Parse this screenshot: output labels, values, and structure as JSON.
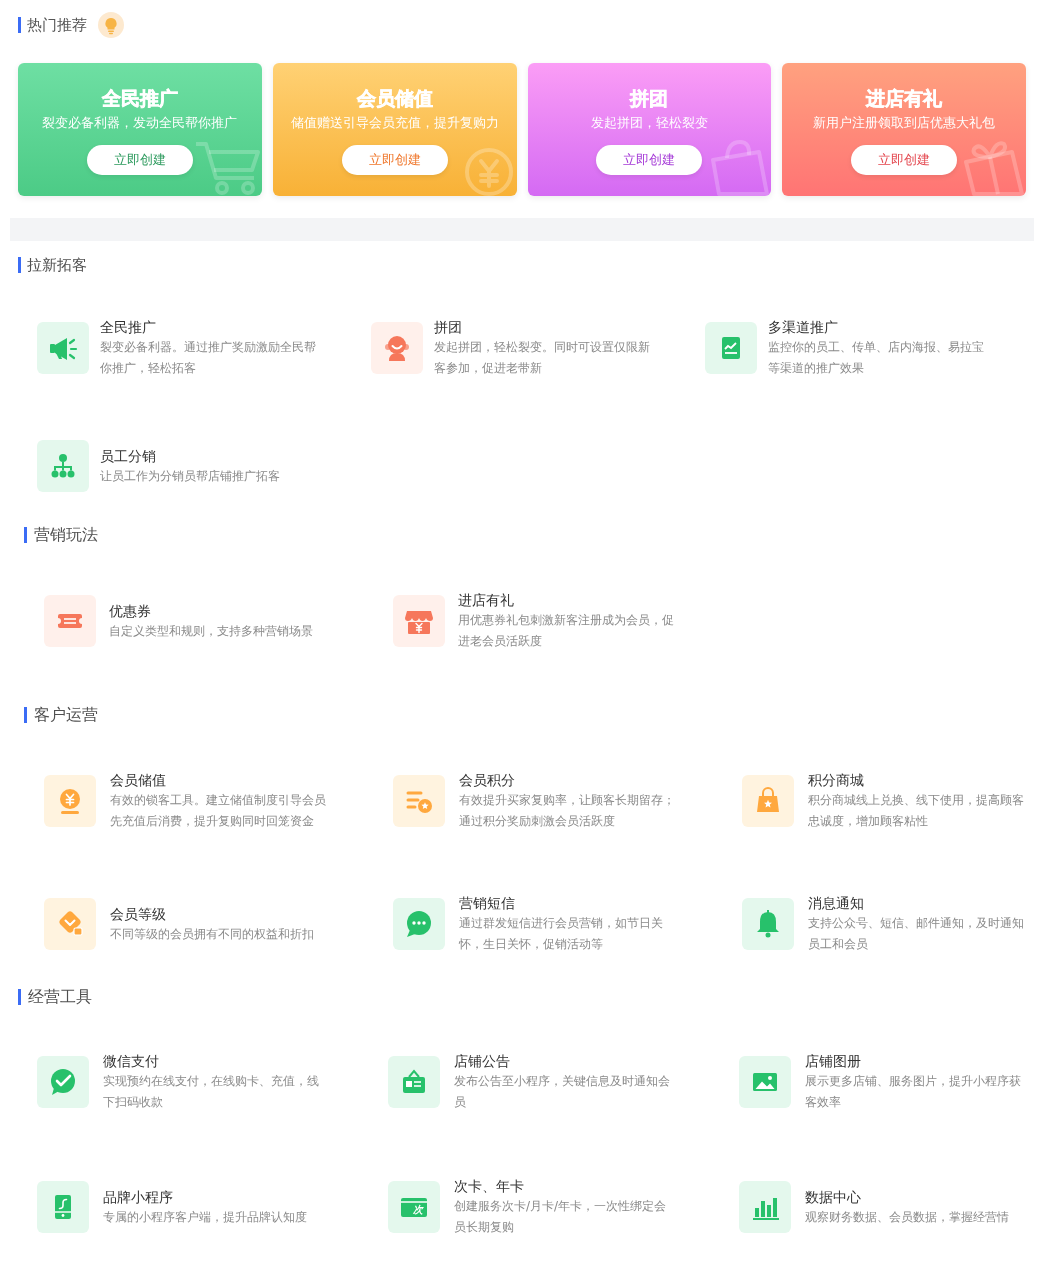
{
  "hot": {
    "title": "热门推荐",
    "cards": [
      {
        "title": "全民推广",
        "subtitle": "裂变必备利器，发动全民帮你推广",
        "button": "立即创建"
      },
      {
        "title": "会员储值",
        "subtitle": "储值赠送引导会员充值，提升复购力",
        "button": "立即创建"
      },
      {
        "title": "拼团",
        "subtitle": "发起拼团，轻松裂变",
        "button": "立即创建"
      },
      {
        "title": "进店有礼",
        "subtitle": "新用户注册领取到店优惠大礼包",
        "button": "立即创建"
      }
    ]
  },
  "sections": [
    {
      "title": "拉新拓客",
      "items": [
        {
          "title": "全民推广",
          "description": "裂变必备利器。通过推广奖励激励全民帮你推广，轻松拓客"
        },
        {
          "title": "拼团",
          "description": "发起拼团，轻松裂变。同时可设置仅限新客参加，促进老带新"
        },
        {
          "title": "多渠道推广",
          "description": "监控你的员工、传单、店内海报、易拉宝等渠道的推广效果"
        },
        {
          "title": "员工分销",
          "description": "让员工作为分销员帮店铺推广拓客"
        }
      ]
    },
    {
      "title": "营销玩法",
      "items": [
        {
          "title": "优惠券",
          "description": "自定义类型和规则，支持多种营销场景"
        },
        {
          "title": "进店有礼",
          "description": "用优惠券礼包刺激新客注册成为会员，促进老会员活跃度"
        }
      ]
    },
    {
      "title": "客户运营",
      "items": [
        {
          "title": "会员储值",
          "description": "有效的锁客工具。建立储值制度引导会员先充值后消费，提升复购同时回笼资金"
        },
        {
          "title": "会员积分",
          "description": "有效提升买家复购率，让顾客长期留存；通过积分奖励刺激会员活跃度"
        },
        {
          "title": "积分商城",
          "description": "积分商城线上兑换、线下使用，提高顾客忠诚度，增加顾客粘性"
        },
        {
          "title": "会员等级",
          "description": "不同等级的会员拥有不同的权益和折扣"
        },
        {
          "title": "营销短信",
          "description": "通过群发短信进行会员营销，如节日关怀，生日关怀，促销活动等"
        },
        {
          "title": "消息通知",
          "description": "支持公众号、短信、邮件通知，及时通知员工和会员"
        }
      ]
    },
    {
      "title": "经营工具",
      "items": [
        {
          "title": "微信支付",
          "description": "实现预约在线支付，在线购卡、充值，线下扫码收款"
        },
        {
          "title": "店铺公告",
          "description": "发布公告至小程序，关键信息及时通知会员"
        },
        {
          "title": "店铺图册",
          "description": "展示更多店铺、服务图片，提升小程序获客效率"
        },
        {
          "title": "品牌小程序",
          "description": "专属的小程序客户端，提升品牌认知度"
        },
        {
          "title": "次卡、年卡",
          "description": "创建服务次卡/月卡/年卡，一次性绑定会员长期复购",
          "icon_label": "次"
        },
        {
          "title": "数据中心",
          "description": "观察财务数据、会员数据，掌握经营情"
        }
      ]
    }
  ]
}
